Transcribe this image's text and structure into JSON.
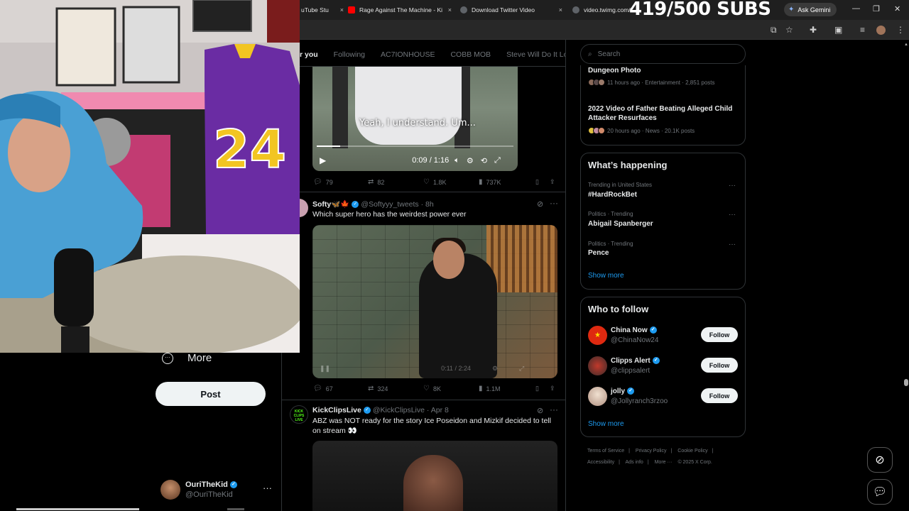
{
  "browser": {
    "tabs": [
      {
        "title": "uTube Stu",
        "fav": "#ff0000"
      },
      {
        "title": "Rage Against The Machine - Ki",
        "fav": "#ff0000"
      },
      {
        "title": "Download Twitter Video",
        "fav": "#9aa0a6"
      },
      {
        "title": "video.twimg.com/a",
        "fav": "#9aa0a6"
      }
    ],
    "overlay_text": "419/500 SUBS",
    "gemini_label": "Ask Gemini",
    "close_glyph": "×"
  },
  "timeline": {
    "tabs": [
      "r you",
      "Following",
      "AC7IONHOUSE",
      "COBB MOB",
      "Steve Will Do It Loyal"
    ],
    "tweet1": {
      "caption": "Yeah, I understand. Um...",
      "time": "0:09 / 1:16",
      "progress_fraction": 0.12,
      "replies": "79",
      "reposts": "82",
      "likes": "1.8K",
      "views": "737K"
    },
    "tweet2": {
      "name": "Softy🦋🍁",
      "handle": "@Softyyy_tweets · 8h",
      "text": "Which super hero has the weirdest power ever",
      "ghost_time": "0:11 / 2:24",
      "replies": "67",
      "reposts": "324",
      "likes": "8K",
      "views": "1.1M"
    },
    "tweet3": {
      "name": "KickClipsLive",
      "handle": "@KickClipsLive · Apr 8",
      "text": "ABZ was NOT ready for the story Ice Poseidon and Mizkif decided to tell on stream 👀",
      "avatar_text": "KICK CLIPS LIVE"
    }
  },
  "sidebar_nav": {
    "more_label": "More",
    "post_label": "Post",
    "account": {
      "name": "OuriTheKid",
      "handle": "@OuriTheKid"
    }
  },
  "search": {
    "placeholder": "Search"
  },
  "news": [
    {
      "title": "Dungeon Photo",
      "meta": "11 hours ago · Entertainment · 2,851 posts"
    },
    {
      "title": "2022 Video of Father Beating Alleged Child Attacker Resurfaces",
      "meta": "20 hours ago · News · 20.1K posts"
    }
  ],
  "happening": {
    "heading": "What’s happening",
    "trends": [
      {
        "context": "Trending in United States",
        "name": "#HardRockBet"
      },
      {
        "context": "Politics · Trending",
        "name": "Abigail Spanberger"
      },
      {
        "context": "Politics · Trending",
        "name": "Pence"
      }
    ],
    "show_more": "Show more"
  },
  "who_to_follow": {
    "heading": "Who to follow",
    "accounts": [
      {
        "name": "China Now",
        "handle": "@ChinaNow24",
        "button": "Follow",
        "color": "#de2910"
      },
      {
        "name": "Clipps Alert",
        "handle": "@clippsalert",
        "button": "Follow",
        "color": "#3a2a2a"
      },
      {
        "name": "jolly",
        "handle": "@Jollyranch3rzoo",
        "button": "Follow",
        "color": "#d9c9b8"
      }
    ],
    "show_more": "Show more"
  },
  "footer": {
    "links": [
      "Terms of Service",
      "|",
      "Privacy Policy",
      "|",
      "Cookie Policy",
      "|",
      "Accessibility",
      "|",
      "Ads info",
      "|",
      "More ···",
      "© 2025 X Corp."
    ]
  },
  "colors": {
    "accent": "#1d9bf0",
    "background": "#000000",
    "border": "#2f3336",
    "muted": "#71767b"
  }
}
